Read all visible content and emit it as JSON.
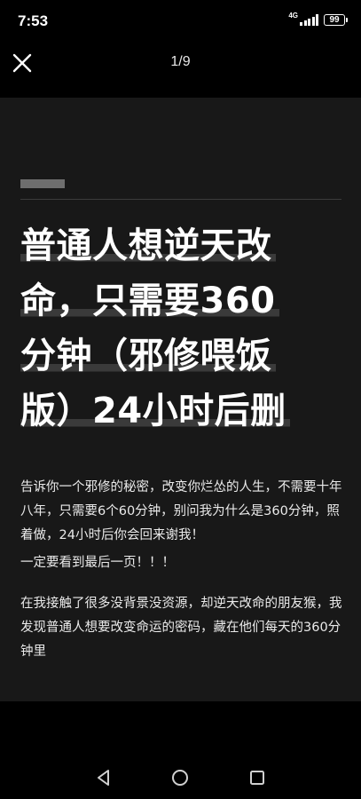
{
  "status": {
    "time": "7:53",
    "network": "4G",
    "battery": "99"
  },
  "top_bar": {
    "page_indicator": "1/9",
    "close_icon": "close-icon"
  },
  "article": {
    "headline_lines": [
      "普通人想逆天改",
      "命，只需要360",
      "分钟（邪修喂饭",
      "版）24小时后删"
    ],
    "paragraphs": [
      "告诉你一个邪修的秘密，改变你烂怂的人生，不需要十年八年，只需要6个60分钟，别问我为什么是360分钟，照着做，24小时后你会回来谢我！",
      "一定要看到最后一页！！！",
      "在我接触了很多没背景没资源，却逆天改命的朋友猴，我发现普通人想要改变命运的密码，藏在他们每天的360分钟里"
    ]
  },
  "nav": {
    "back_icon": "back-triangle-icon",
    "home_icon": "home-circle-icon",
    "recents_icon": "recents-square-icon"
  },
  "colors": {
    "background": "#000000",
    "card": "#181818",
    "text": "#ffffff",
    "highlight": "#3a3a3a"
  }
}
